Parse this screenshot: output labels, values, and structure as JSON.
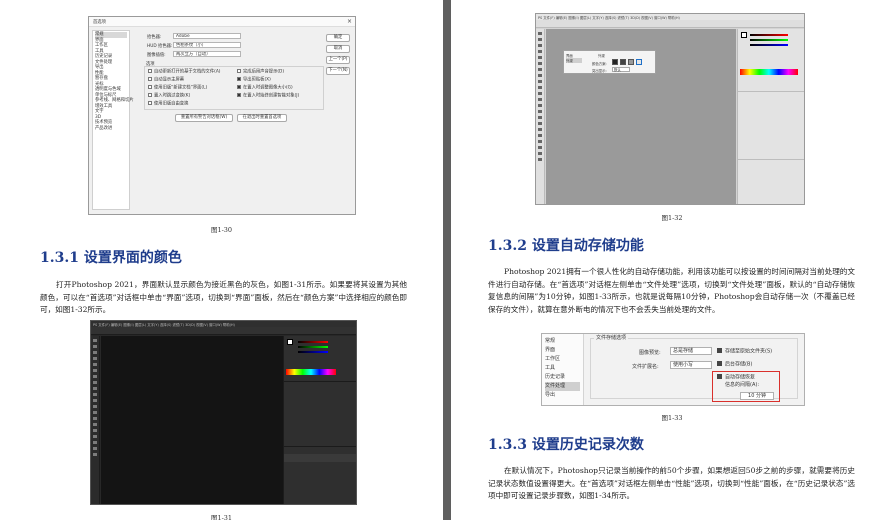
{
  "left_page": {
    "fig30": {
      "caption": "图1-30",
      "dialog": {
        "title": "首选项",
        "close": "×",
        "nav_items": [
          "常规",
          "界面",
          "工作区",
          "工具",
          "历史记录",
          "文件处理",
          "导出",
          "性能",
          "暂存盘",
          "光标",
          "透明度与色域",
          "单位与标尺",
          "参考线、网格和切片",
          "增效工具",
          "文字",
          "3D",
          "技术预览",
          "产品改进"
        ],
        "fields": [
          {
            "label": "拾色器:",
            "value": "Adobe"
          },
          {
            "label": "HUD 拾色器:",
            "value": "色相条纹（小）"
          },
          {
            "label": "图像插值:",
            "value": "两次立方（自动）"
          }
        ],
        "options_label": "选项",
        "options": [
          {
            "label": "自动更新打开的基于文档的文件(A)",
            "checked": false
          },
          {
            "label": "完成后用声音提示(D)",
            "checked": false
          },
          {
            "label": "自动显示主屏幕",
            "checked": false
          },
          {
            "label": "导出剪贴板(X)",
            "checked": true
          },
          {
            "label": "使用旧版“新建文档”界面(L)",
            "checked": false
          },
          {
            "label": "在置入时调整图像大小(G)",
            "checked": true
          },
          {
            "label": "置入时跳过变换(K)",
            "checked": false
          },
          {
            "label": "在置入时始终创建智能对象(J)",
            "checked": true
          },
          {
            "label": "使用旧版自由变换",
            "checked": false
          }
        ],
        "buttons": [
          "确定",
          "取消",
          "上一个(P)",
          "下一个(N)"
        ],
        "bottom_buttons": [
          "重置所有警告对话框(W)",
          "在退出时重置首选项"
        ]
      }
    },
    "section_131": {
      "heading": "1.3.1 设置界面的颜色",
      "paragraph": "打开Photoshop 2021，界面默认显示颜色为接近黑色的灰色，如图1-31所示。如果要将其设置为其他颜色，可以在“首选项”对话框中单击“界面”选项，切换到“界面”面板，然后在“颜色方案”中选择相应的颜色即可，如图1-32所示。"
    },
    "fig31": {
      "caption": "图1-31",
      "menu": "PS 文件(F) 编辑(E) 图像(I) 图层(L) 文字(Y) 选择(S) 滤镜(T) 3D(D) 视图(V) 窗口(W) 帮助(H)"
    }
  },
  "right_page": {
    "fig32": {
      "caption": "图1-32",
      "menu": "PS 文件(F) 编辑(E) 图像(I) 图层(L) 文字(Y) 选择(S) 滤镜(T) 3D(D) 视图(V) 窗口(W) 帮助(H)",
      "popup_items": [
        "界面",
        "外观",
        "颜色方案:",
        "突出显示:"
      ],
      "popup_value": "默认"
    },
    "section_132": {
      "heading": "1.3.2 设置自动存储功能",
      "paragraph": "Photoshop 2021拥有一个很人性化的自动存储功能，利用该功能可以按设置的时间间隔对当前处理的文件进行自动存储。在“首选项”对话框左侧单击“文件处理”选项，切换到“文件处理”面板，默认的“自动存储恢复信息的间隔”为10分钟，如图1-33所示，也就是说每隔10分钟，Photoshop会自动存储一次（不覆盖已经保存的文件），就算在意外断电的情况下也不会丢失当前处理的文件。"
    },
    "fig33": {
      "caption": "图1-33",
      "nav_items": [
        "常规",
        "界面",
        "工作区",
        "工具",
        "历史记录",
        "文件处理",
        "导出"
      ],
      "selected_nav": "文件处理",
      "group_title": "文件存储选项",
      "preview_label": "图像预览:",
      "preview_value": "总是存储",
      "ext_label": "文件扩展名:",
      "ext_value": "使用小写",
      "check1": "存储至原始文件夹(S)",
      "check2": "后台存储(B)",
      "check3_line1": "自动存储恢复",
      "check3_line2": "信息的间隔(A):",
      "interval": "10 分钟"
    },
    "section_133": {
      "heading": "1.3.3 设置历史记录次数",
      "paragraph": "在默认情况下，Photoshop只记录当前操作的前50个步骤，如果想返回50步之前的步骤，就需要将历史记录状态数值设置得更大。在“首选项”对话框左侧单击“性能”选项，切换到“性能”面板，在“历史记录状态”选项中即可设置记录步骤数，如图1-34所示。"
    }
  }
}
